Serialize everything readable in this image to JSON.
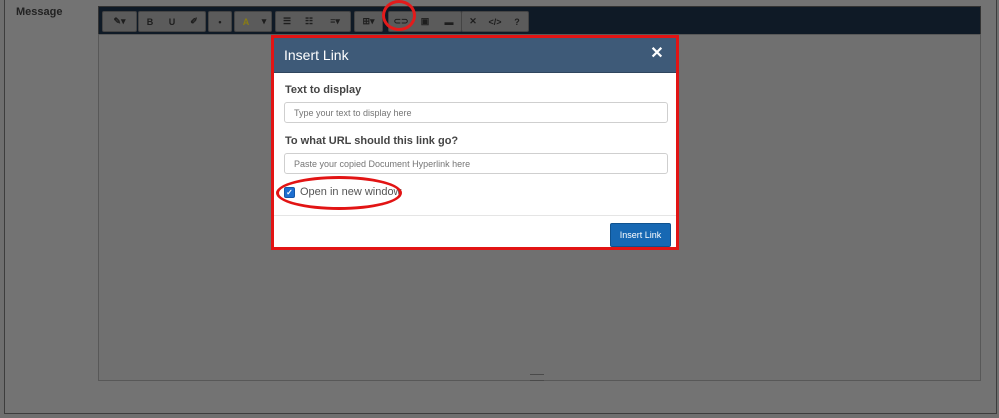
{
  "form": {
    "message_label": "Message"
  },
  "toolbar": {
    "buttons": [
      {
        "icon": "magic-wand-icon",
        "glyph": "✎▾"
      },
      {
        "icon": "bold-icon",
        "glyph": "B"
      },
      {
        "icon": "underline-icon",
        "glyph": "U"
      },
      {
        "icon": "eraser-icon",
        "glyph": "✐"
      },
      {
        "icon": "font-size-icon",
        "glyph": "•"
      },
      {
        "icon": "text-color-icon",
        "glyph": "A"
      },
      {
        "icon": "text-color-dropdown-icon",
        "glyph": "▾"
      },
      {
        "icon": "unordered-list-icon",
        "glyph": "☰"
      },
      {
        "icon": "ordered-list-icon",
        "glyph": "☷"
      },
      {
        "icon": "paragraph-align-icon",
        "glyph": "≡▾"
      },
      {
        "icon": "table-icon",
        "glyph": "⊞▾"
      },
      {
        "icon": "link-icon",
        "glyph": "⊂⊃"
      },
      {
        "icon": "picture-icon",
        "glyph": "▣"
      },
      {
        "icon": "horizontal-rule-icon",
        "glyph": "▬"
      },
      {
        "icon": "fullscreen-icon",
        "glyph": "✕"
      },
      {
        "icon": "code-view-icon",
        "glyph": "</>"
      },
      {
        "icon": "help-icon",
        "glyph": "?"
      }
    ]
  },
  "modal": {
    "title": "Insert Link",
    "close_glyph": "✕",
    "text_label": "Text to display",
    "text_placeholder": "Type your text to display here",
    "url_label": "To what URL should this link go?",
    "url_placeholder": "Paste your copied Document Hyperlink here",
    "new_window_label": "Open in new window",
    "new_window_checked": true,
    "insert_button": "Insert Link"
  },
  "colors": {
    "overlay": "#6f6f6f",
    "modal_header": "#3e5a78",
    "primary_button": "#1768b3",
    "annotation_red": "#e21414",
    "checkbox_blue": "#1e6fd0"
  }
}
